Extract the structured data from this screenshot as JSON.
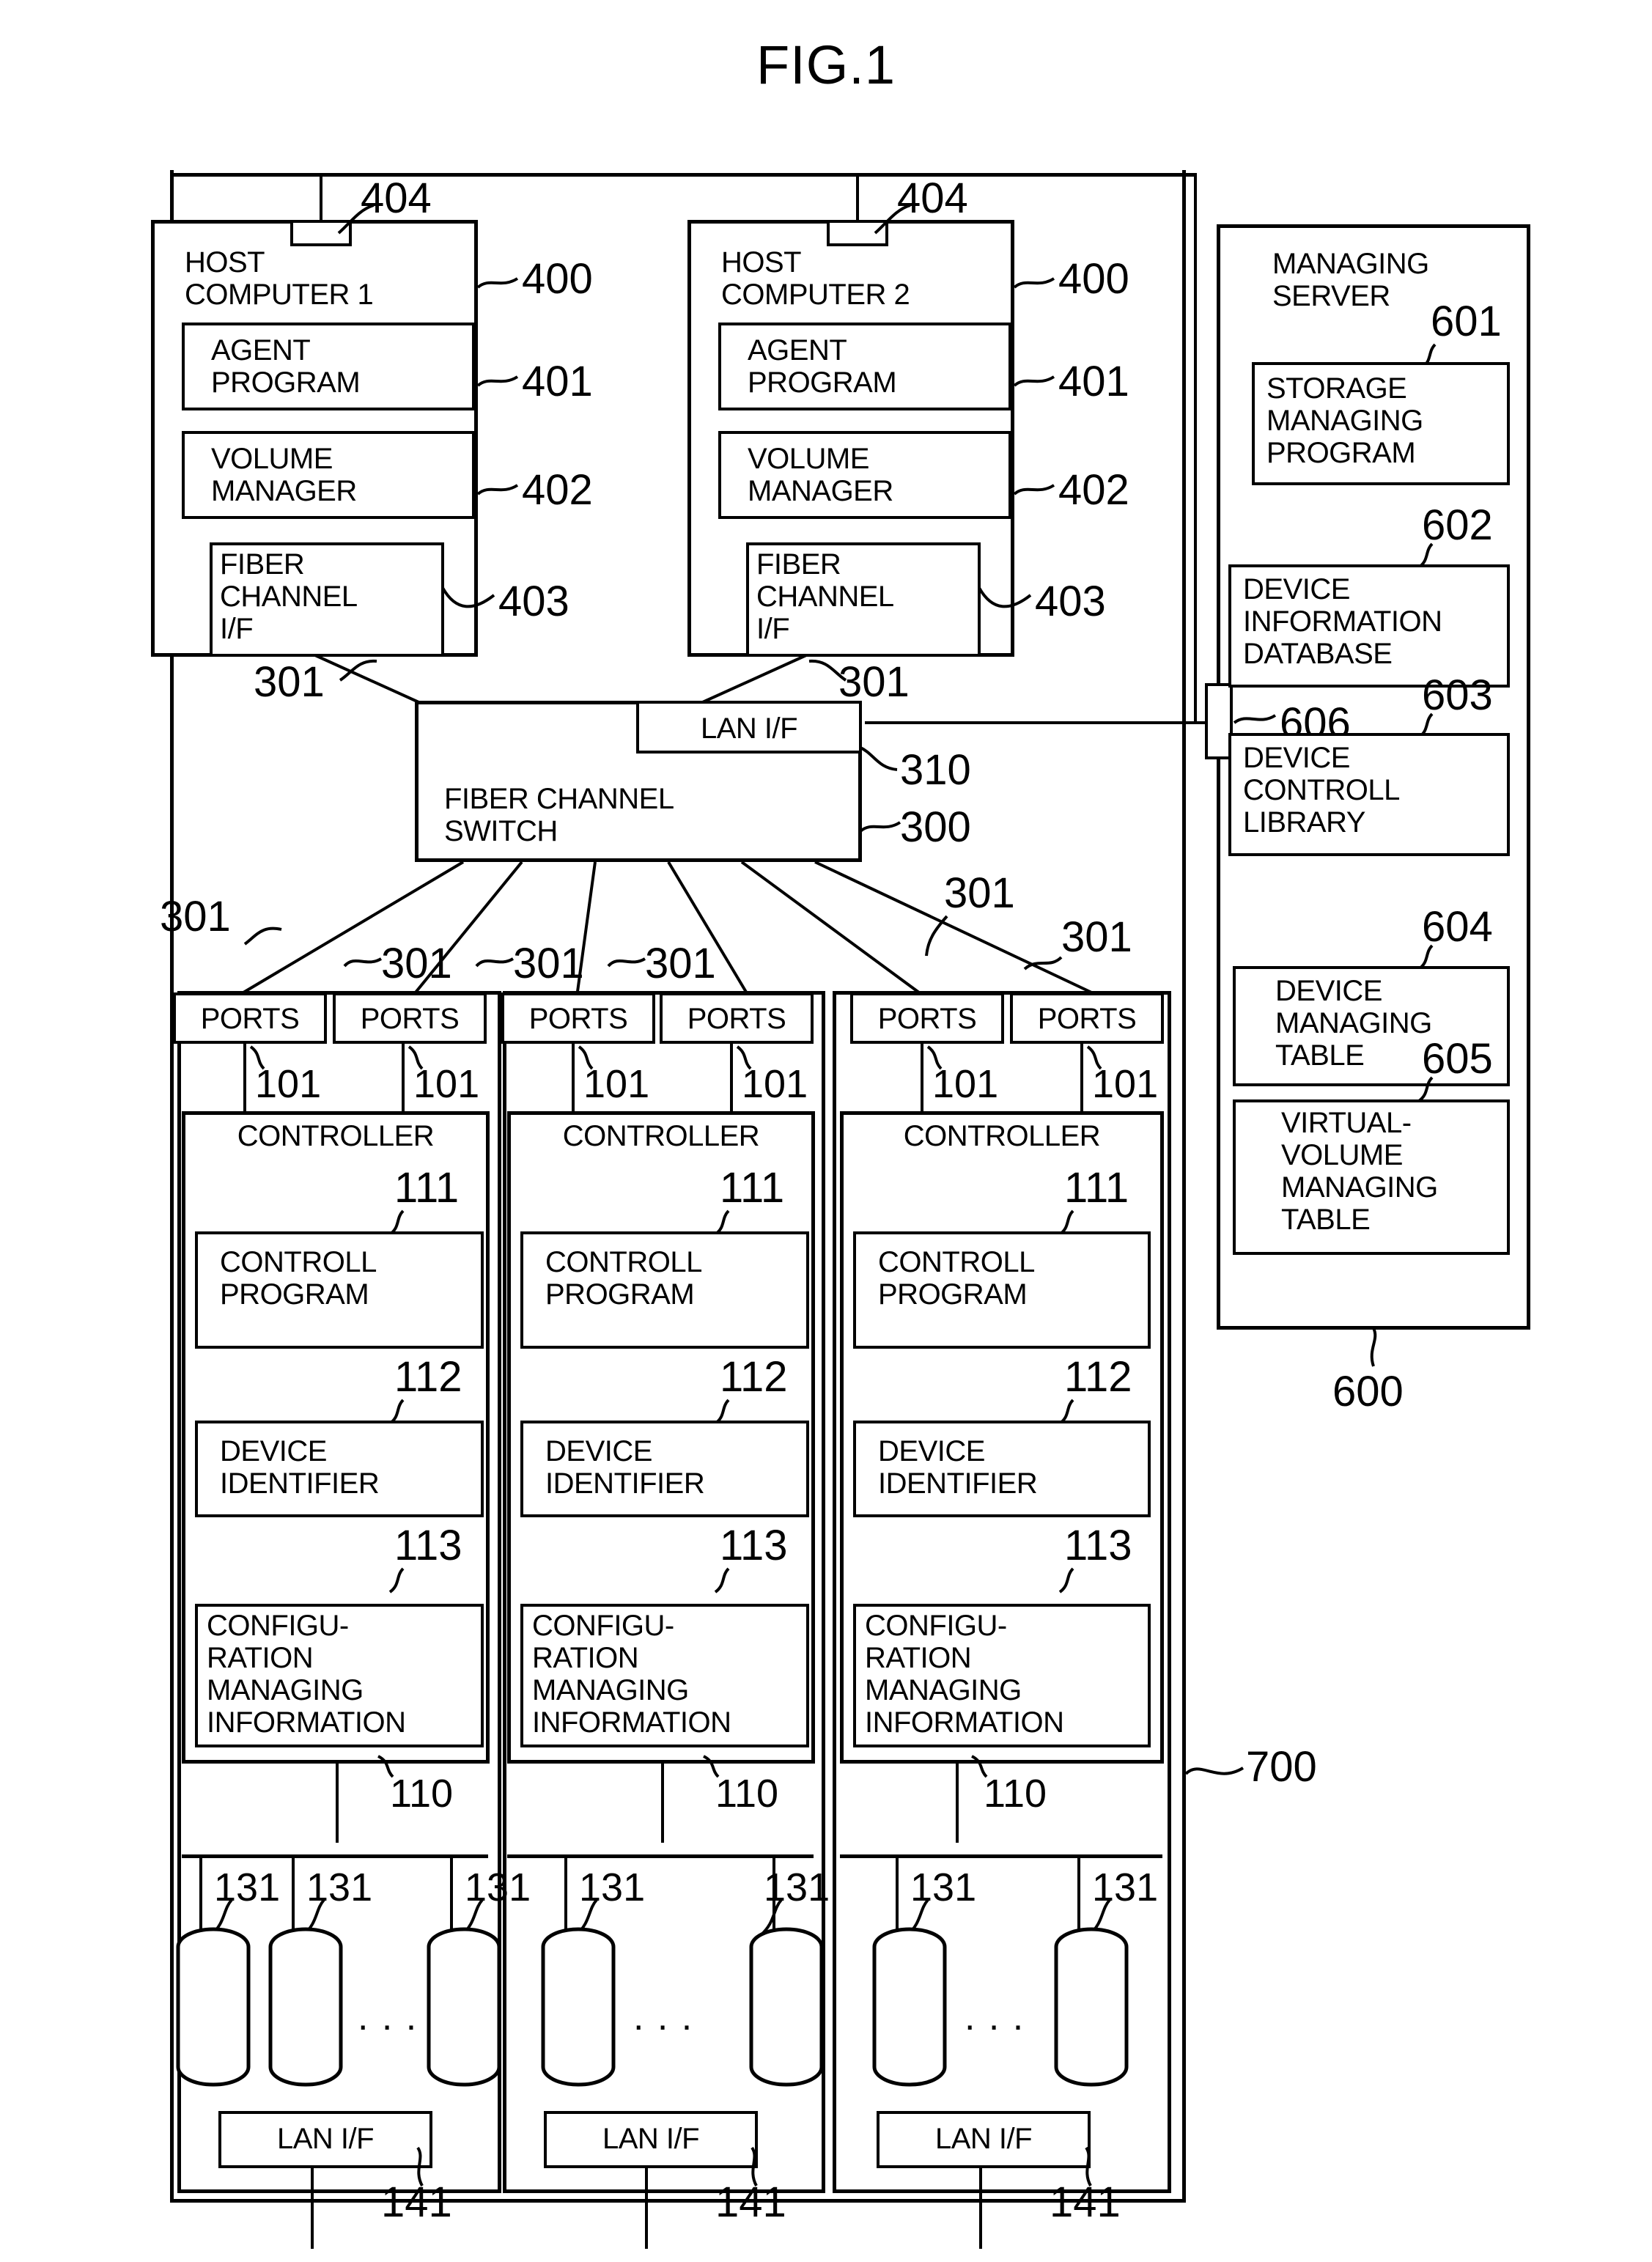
{
  "figure": {
    "title": "FIG.1",
    "system_ref": "700",
    "lan_bus_ref": "404"
  },
  "hosts": [
    {
      "name": "HOST\nCOMPUTER 1",
      "ref": "400",
      "lan_if_ref": "404",
      "fc_link_ref": "301",
      "modules": [
        {
          "label": "AGENT\nPROGRAM",
          "ref": "401"
        },
        {
          "label": "VOLUME\nMANAGER",
          "ref": "402"
        },
        {
          "label": "FIBER\nCHANNEL\nI/F",
          "ref": "403"
        }
      ]
    },
    {
      "name": "HOST\nCOMPUTER 2",
      "ref": "400",
      "lan_if_ref": "404",
      "fc_link_ref": "301",
      "modules": [
        {
          "label": "AGENT\nPROGRAM",
          "ref": "401"
        },
        {
          "label": "VOLUME\nMANAGER",
          "ref": "402"
        },
        {
          "label": "FIBER\nCHANNEL\nI/F",
          "ref": "403"
        }
      ]
    }
  ],
  "switch": {
    "label": "FIBER CHANNEL\nSWITCH",
    "ref": "300",
    "lan_if_label": "LAN I/F",
    "lan_if_ref": "310"
  },
  "managing_server": {
    "title": "MANAGING\nSERVER",
    "ref": "600",
    "lan_if_ref": "606",
    "modules": [
      {
        "label": "STORAGE\nMANAGING\nPROGRAM",
        "ref": "601"
      },
      {
        "label": "DEVICE\nINFORMATION\nDATABASE",
        "ref": "602"
      },
      {
        "label": "DEVICE\nCONTROLL\nLIBRARY",
        "ref": "603"
      },
      {
        "label": "DEVICE\nMANAGING\nTABLE",
        "ref": "604"
      },
      {
        "label": "VIRTUAL-\nVOLUME\nMANAGING\nTABLE",
        "ref": "605"
      }
    ]
  },
  "storage": {
    "ports_label": "PORTS",
    "port_ref": "101",
    "fc_link_ref": "301",
    "controller_label": "CONTROLLER",
    "controller_ref": "110",
    "control_program_label": "CONTROLL\nPROGRAM",
    "control_program_ref": "111",
    "device_identifier_label": "DEVICE\nIDENTIFIER",
    "device_identifier_ref": "112",
    "config_info_label": "CONFIGU-\nRATION\nMANAGING\nINFORMATION",
    "config_info_ref": "113",
    "disk_ref": "131",
    "lan_if_label": "LAN I/F",
    "lan_if_ref": "141",
    "ellipsis_wide": ". . . .",
    "ellipsis_narrow": ". . .",
    "subsystems": [
      {
        "ports": 2,
        "disks": 2,
        "ellipsis": true
      },
      {
        "ports": 2,
        "disks": 1,
        "ellipsis": false
      },
      {
        "ports": 2,
        "disks": 2,
        "ellipsis": true
      }
    ]
  },
  "fc_link_refs_top": [
    "301",
    "301",
    "301",
    "301",
    "301",
    "301",
    "301"
  ]
}
